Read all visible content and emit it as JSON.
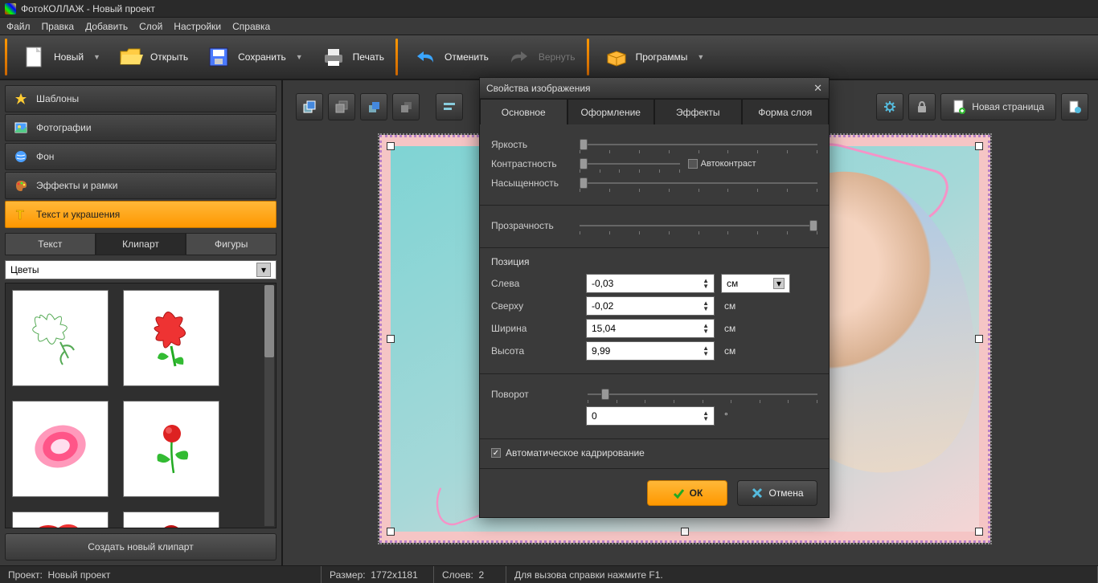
{
  "window": {
    "title": "ФотоКОЛЛАЖ - Новый проект"
  },
  "menu": {
    "file": "Файл",
    "edit": "Правка",
    "add": "Добавить",
    "layer": "Слой",
    "settings": "Настройки",
    "help": "Справка"
  },
  "toolbar": {
    "new": "Новый",
    "open": "Открыть",
    "save": "Сохранить",
    "print": "Печать",
    "undo": "Отменить",
    "redo": "Вернуть",
    "programs": "Программы"
  },
  "leftTabs": {
    "templates": "Шаблоны",
    "photos": "Фотографии",
    "background": "Фон",
    "effects": "Эффекты и рамки",
    "text": "Текст и украшения"
  },
  "subtabs": {
    "text": "Текст",
    "clipart": "Клипарт",
    "shapes": "Фигуры"
  },
  "combo": {
    "flowers": "Цветы"
  },
  "createClipart": "Создать новый клипарт",
  "newPage": "Новая страница",
  "dialog": {
    "title": "Свойства изображения",
    "tabs": {
      "main": "Основное",
      "design": "Оформление",
      "effects": "Эффекты",
      "shape": "Форма слоя"
    },
    "brightness": "Яркость",
    "contrast": "Контрастность",
    "saturation": "Насыщенность",
    "autocontrast": "Автоконтраст",
    "opacity": "Прозрачность",
    "position": "Позиция",
    "left": "Слева",
    "top": "Сверху",
    "width": "Ширина",
    "height": "Высота",
    "rotation": "Поворот",
    "autocrop": "Автоматическое кадрирование",
    "values": {
      "left": "-0,03",
      "top": "-0,02",
      "width": "15,04",
      "height": "9,99",
      "rotation": "0"
    },
    "unit": "см",
    "degree": "°",
    "ok": "ОК",
    "cancel": "Отмена"
  },
  "status": {
    "project_label": "Проект:",
    "project": "Новый проект",
    "size_label": "Размер:",
    "size": "1772x1181",
    "layers_label": "Слоев:",
    "layers": "2",
    "help": "Для вызова справки нажмите F1."
  }
}
